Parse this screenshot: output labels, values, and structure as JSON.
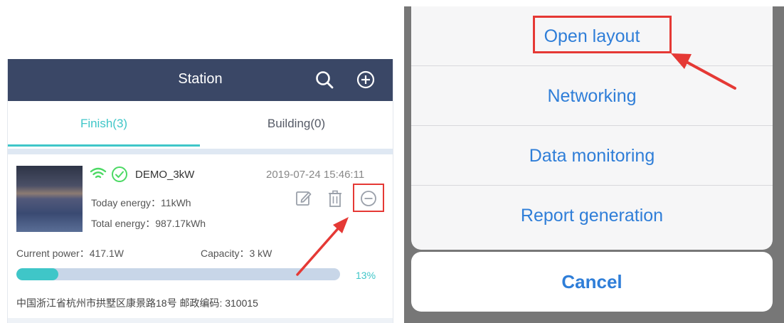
{
  "left": {
    "nav": {
      "title": "Station"
    },
    "tabs": [
      {
        "label": "Finish(3)"
      },
      {
        "label": "Building(0)"
      }
    ],
    "station": {
      "name": "DEMO_3kW",
      "time": "2019-07-24 15:46:11",
      "today_energy": "Today energy：11kWh",
      "total_energy": "Total energy：987.17kWh",
      "current_power": "Current power：417.1W",
      "capacity": "Capacity：3 kW",
      "progress_value": 13,
      "progress_text": "13%",
      "address": "中国浙江省杭州市拱墅区康景路18号 邮政编码: 310015"
    }
  },
  "right": {
    "menu": [
      {
        "label": "Open layout"
      },
      {
        "label": "Networking"
      },
      {
        "label": "Data monitoring"
      },
      {
        "label": "Report generation"
      }
    ],
    "cancel": "Cancel"
  },
  "colors": {
    "nav_bg": "#3a4766",
    "accent_teal": "#3fc6c8",
    "ios_blue": "#2f7ed8",
    "annotation_red": "#e53935",
    "wifi_green": "#4cd964"
  },
  "icons": [
    "search-icon",
    "add-circle-icon",
    "wifi-icon",
    "check-circle-icon",
    "edit-icon",
    "delete-icon",
    "remove-circle-icon"
  ]
}
